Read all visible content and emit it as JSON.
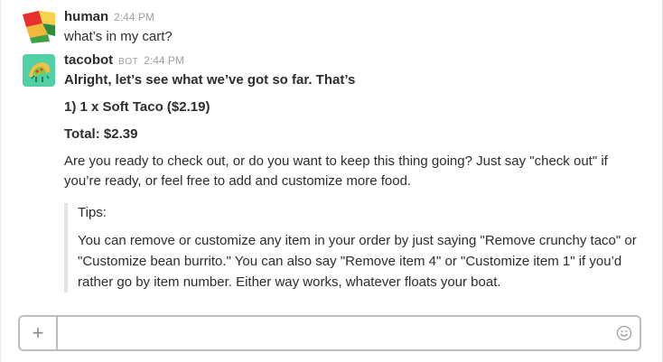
{
  "messages": [
    {
      "username": "human",
      "time": "2:44 PM",
      "text": "what’s in my cart?"
    },
    {
      "username": "tacobot",
      "badge": "BOT",
      "time": "2:44 PM",
      "intro": "Alright, let’s see what we’ve got so far. That’s",
      "item_line": "1) 1 x Soft Taco ($2.19)",
      "total_line": "Total: $2.39",
      "prompt": "Are you ready to check out, or do you want to keep this thing going? Just say \"check out\" if you’re ready, or feel free to add and customize more food.",
      "attachment": {
        "label": "Tips:",
        "body": "You can remove or customize any item in your order by just saying \"Remove crunchy taco\" or \"Customize bean burrito.\" You can also say \"Remove item 4\" or \"Customize item 1\" if you’d rather go by item number. Either way works, whatever floats your boat."
      }
    }
  ],
  "composer": {
    "plus_label": "+",
    "value": "",
    "placeholder": ""
  },
  "icons": {
    "plus": "plus-icon",
    "emoji": "emoji-icon"
  },
  "colors": {
    "avatar_tacobot_bg": "#4fd1a5",
    "attachment_bar": "#e3e4e6"
  }
}
